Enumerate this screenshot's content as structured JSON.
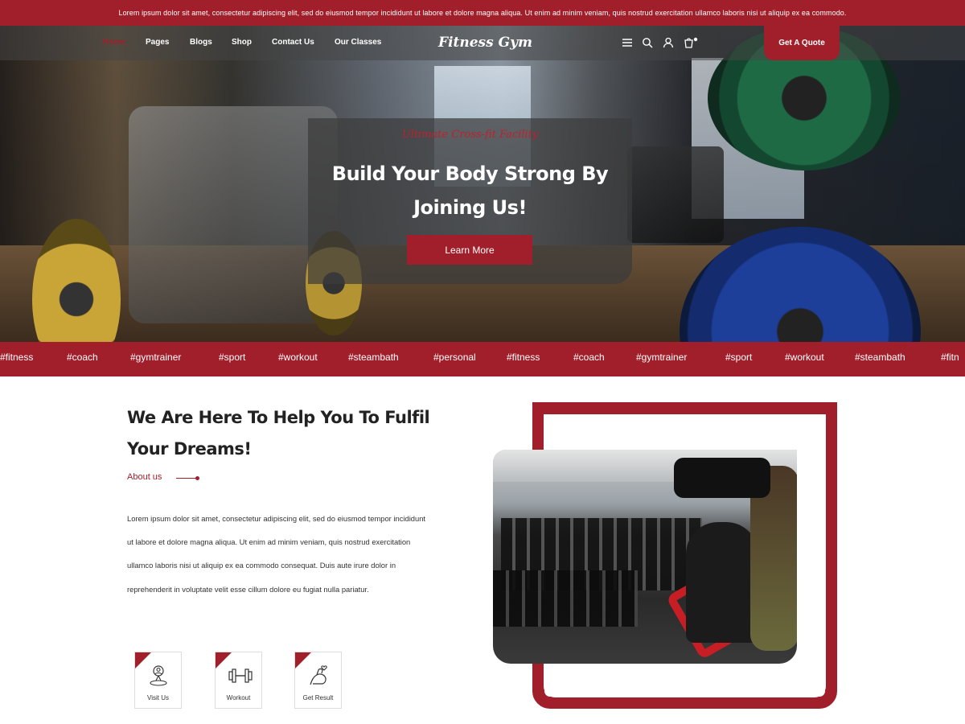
{
  "topbar": {
    "text": "Lorem ipsum dolor sit amet, consectetur adipiscing elit, sed do eiusmod tempor incididunt ut labore et dolore magna aliqua. Ut enim ad minim veniam, quis nostrud exercitation ullamco laboris nisi ut aliquip ex ea commodo."
  },
  "nav": {
    "items": [
      "Home",
      "Pages",
      "Blogs",
      "Shop",
      "Contact Us",
      "Our Classes"
    ],
    "active": "Home",
    "logo": "Fitness Gym",
    "quote_button": "Get A Quote",
    "icons": [
      "menu-icon",
      "search-icon",
      "user-icon",
      "cart-icon"
    ]
  },
  "hero": {
    "subtitle": "Ultimate Cross-fit Facility",
    "title": "Build Your Body Strong By Joining Us!",
    "button": "Learn More"
  },
  "tags": [
    "#fitness",
    "#coach",
    "#gymtrainer",
    "#sport",
    "#workout",
    "#steambath",
    "#personal",
    "#fitness",
    "#coach",
    "#gymtrainer",
    "#sport",
    "#workout",
    "#steambath",
    "#fitn"
  ],
  "about": {
    "title": "We Are Here To Help You To Fulfil Your Dreams!",
    "label": "About us",
    "text": "Lorem ipsum dolor sit amet, consectetur adipiscing elit, sed do eiusmod tempor incididunt ut labore et dolore magna aliqua. Ut enim ad minim veniam, quis nostrud exercitation ullamco laboris nisi ut aliquip ex ea commodo consequat. Duis aute irure dolor in reprehenderit in voluptate velit esse cillum dolore eu fugiat nulla pariatur.",
    "features": [
      {
        "label": "Visit Us",
        "icon": "location-icon"
      },
      {
        "label": "Workout",
        "icon": "dumbbell-icon"
      },
      {
        "label": "Get Result",
        "icon": "muscle-icon"
      }
    ]
  },
  "colors": {
    "accent": "#a11f2b",
    "text": "#222222"
  }
}
